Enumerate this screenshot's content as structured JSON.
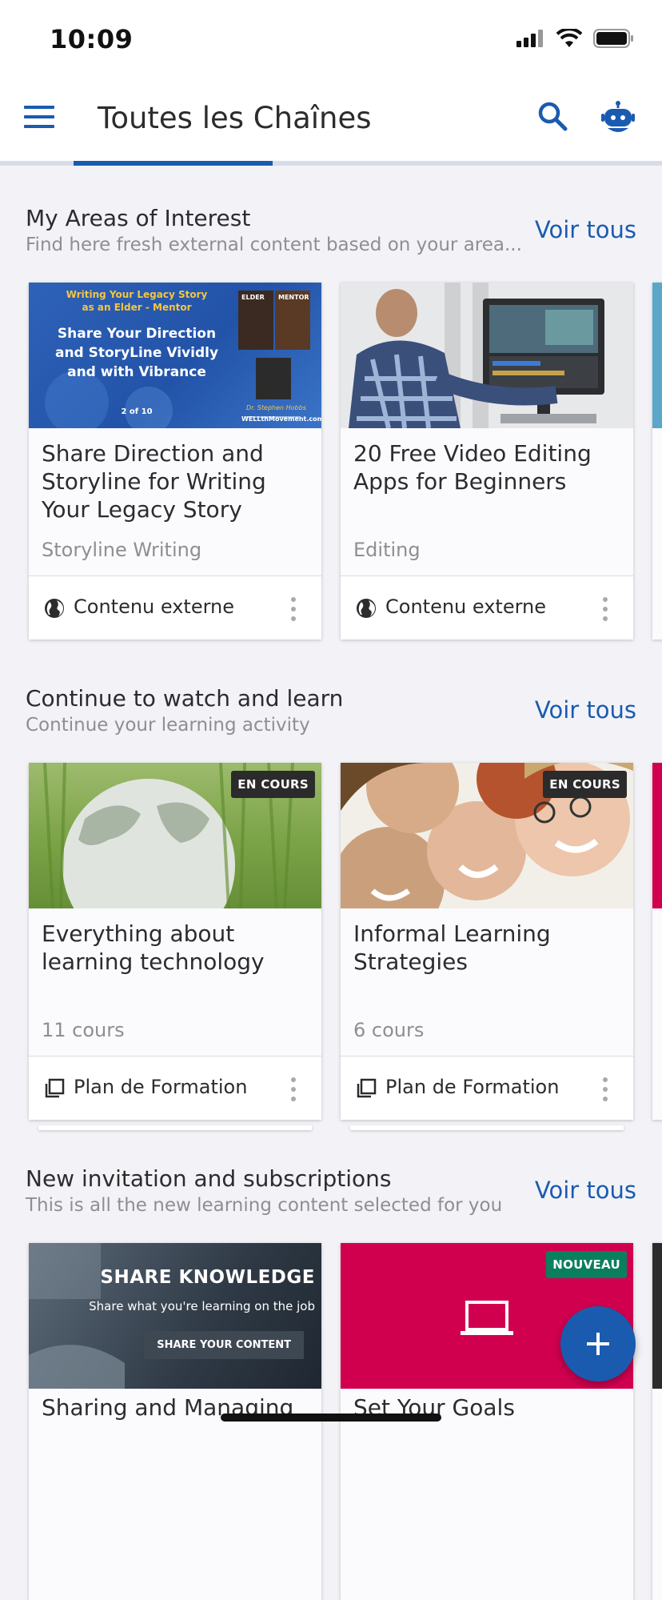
{
  "status_bar": {
    "time": "10:09"
  },
  "header": {
    "title": "Toutes les Chaînes",
    "colors": {
      "accent": "#1a5bb0"
    }
  },
  "sections": [
    {
      "title": "My Areas of Interest",
      "subtitle": "Find here fresh external content based on your area...",
      "view_all": "Voir tous",
      "cards": [
        {
          "thumb_lines": [
            "Writing Your Legacy Story",
            "as an Elder - Mentor",
            "Share Your Direction",
            "and StoryLine Vividly",
            "and with Vibrance",
            "2 of 10",
            "ELDER",
            "MENTOR",
            "Dr. Stephen Hobbs",
            "WELLthMovement.com"
          ],
          "title": "Share Direction and Storyline for Writing Your Legacy Story",
          "meta": "Storyline Writing",
          "footer": "Contenu externe",
          "footer_icon": "globe-icon"
        },
        {
          "title": "20 Free Video Editing Apps for Beginners",
          "meta": "Editing",
          "footer": "Contenu externe",
          "footer_icon": "globe-icon"
        }
      ]
    },
    {
      "title": "Continue to watch and learn",
      "subtitle": "Continue your learning activity",
      "view_all": "Voir tous",
      "cards": [
        {
          "badge": "EN COURS",
          "title": "Everything about learning technology",
          "meta": "11 cours",
          "footer": "Plan de Formation",
          "footer_icon": "stack-icon"
        },
        {
          "badge": "EN COURS",
          "title": "Informal Learning Strategies",
          "meta": "6 cours",
          "footer": "Plan de Formation",
          "footer_icon": "stack-icon"
        }
      ]
    },
    {
      "title": "New invitation and subscriptions",
      "subtitle": "This is all the new learning content selected for you",
      "view_all": "Voir tous",
      "cards": [
        {
          "thumb_lines": [
            "SHARE KNOWLEDGE",
            "Share what you're learning on the job",
            "SHARE YOUR CONTENT"
          ],
          "title": "Sharing and Managing"
        },
        {
          "badge": "NOUVEAU",
          "title": "Set Your Goals"
        }
      ]
    }
  ]
}
